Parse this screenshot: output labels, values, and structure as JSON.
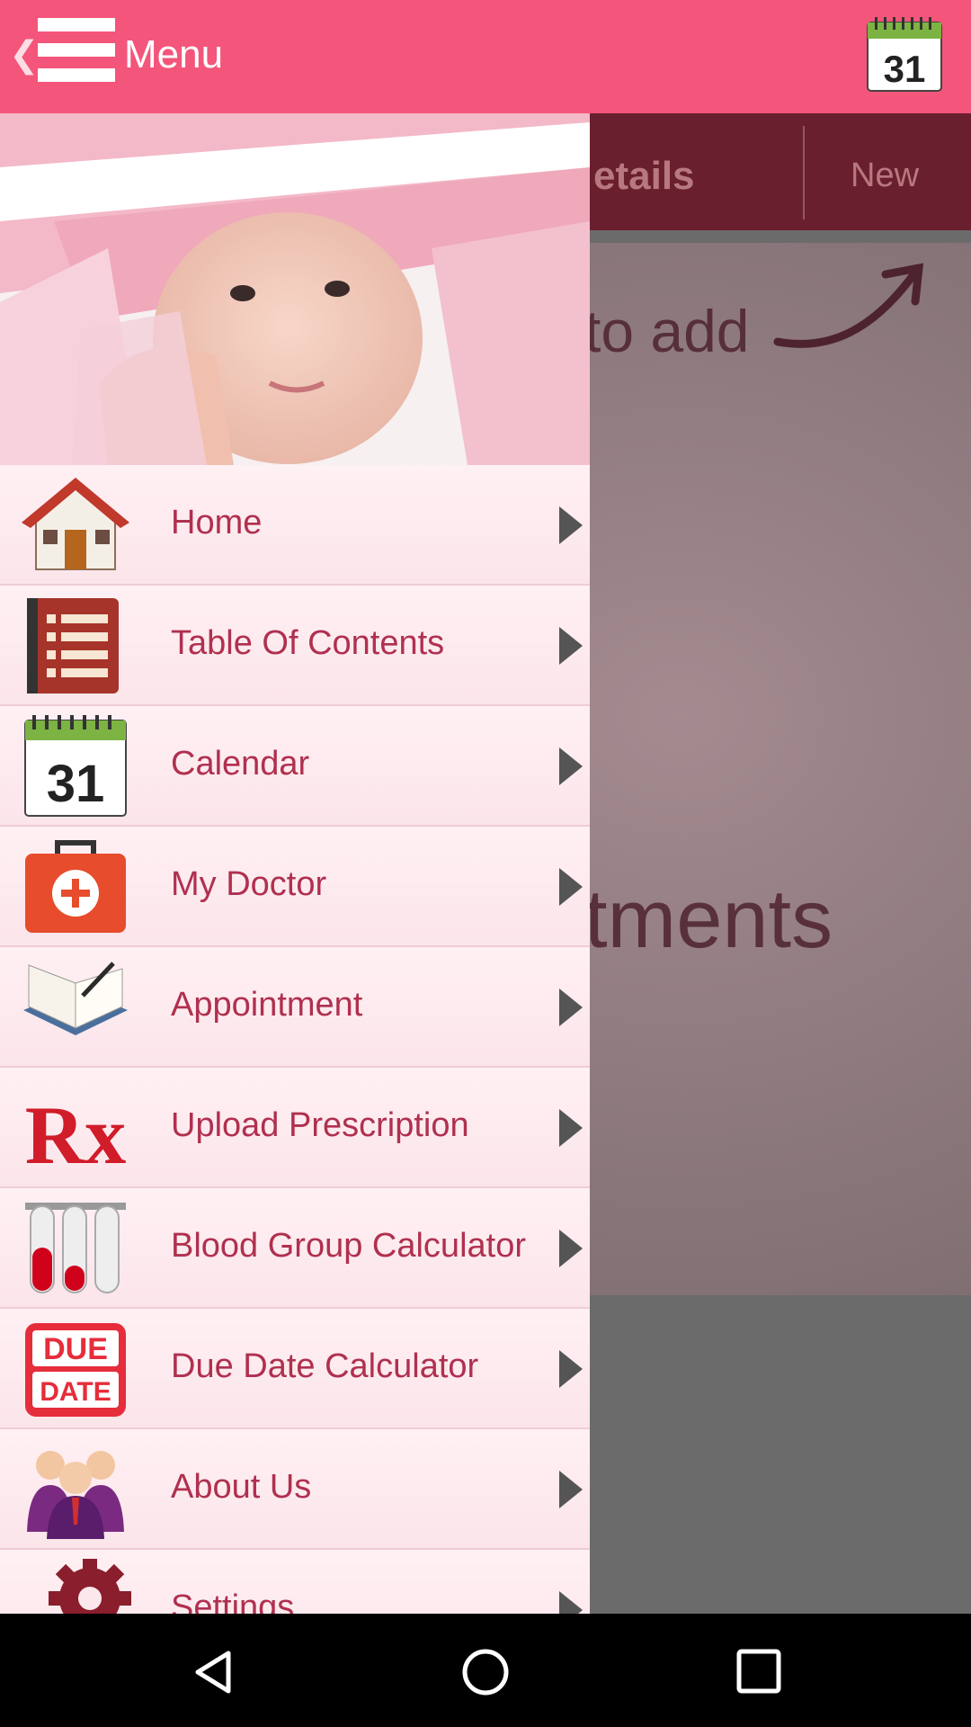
{
  "appbar": {
    "title": "Menu",
    "calendar_day": "31",
    "color": "#f4557a"
  },
  "background": {
    "tab_details": "etails",
    "tab_new": "New",
    "hint_top": "to add",
    "hint_bottom": "tments"
  },
  "drawer": {
    "items": [
      {
        "label": "Home",
        "icon": "house-icon"
      },
      {
        "label": "Table Of Contents",
        "icon": "notebook-icon"
      },
      {
        "label": "Calendar",
        "icon": "calendar-icon",
        "day": "31"
      },
      {
        "label": "My Doctor",
        "icon": "medical-kit-icon"
      },
      {
        "label": "Appointment",
        "icon": "open-book-icon"
      },
      {
        "label": "Upload Prescription",
        "icon": "rx-icon",
        "glyph": "Rx"
      },
      {
        "label": "Blood Group Calculator",
        "icon": "test-tubes-icon"
      },
      {
        "label": "Due Date Calculator",
        "icon": "due-date-icon",
        "line1": "DUE",
        "line2": "DATE"
      },
      {
        "label": "About Us",
        "icon": "people-icon"
      },
      {
        "label": "Settings",
        "icon": "gear-icon"
      }
    ]
  },
  "navbar": {
    "back": "back-icon",
    "home": "home-circle-icon",
    "recents": "recents-icon"
  }
}
